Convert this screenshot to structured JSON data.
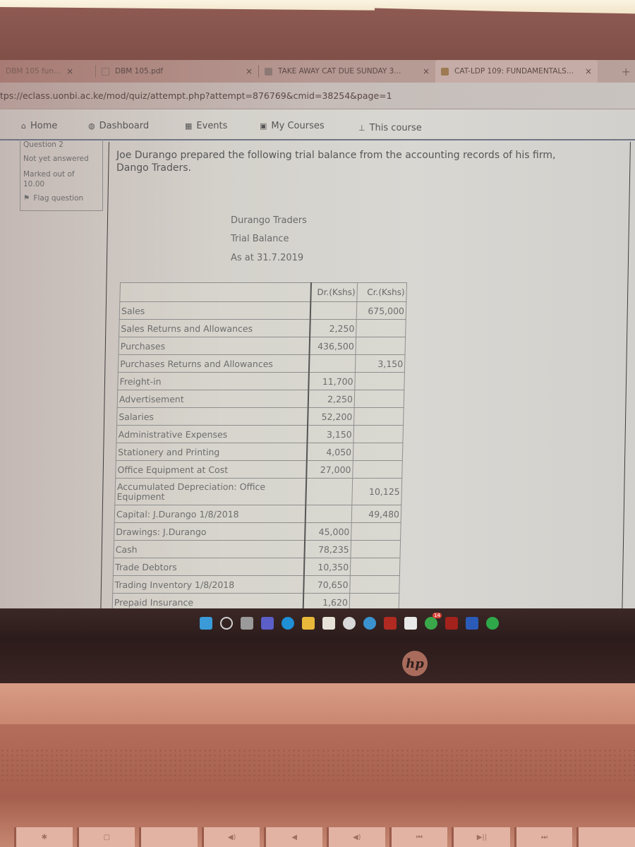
{
  "browser": {
    "tabs": [
      {
        "label": "DBM 105 fun...",
        "active": false
      },
      {
        "label": "DBM 105.pdf",
        "active": false
      },
      {
        "label": "TAKE AWAY CAT DUE SUNDAY 3...",
        "active": false
      },
      {
        "label": "CAT-LDP 109: FUNDAMENTALS...",
        "active": true
      }
    ],
    "close_glyph": "×",
    "new_tab_glyph": "+",
    "url": "tps://eclass.uonbi.ac.ke/mod/quiz/attempt.php?attempt=876769&cmid=38254&page=1"
  },
  "nav": {
    "items": [
      {
        "label": "Home",
        "icon": "home-icon",
        "glyph": "⌂"
      },
      {
        "label": "Dashboard",
        "icon": "dashboard-icon",
        "glyph": "◍"
      },
      {
        "label": "Events",
        "icon": "calendar-icon",
        "glyph": "▦"
      },
      {
        "label": "My Courses",
        "icon": "briefcase-icon",
        "glyph": "▣"
      },
      {
        "label": "This course",
        "icon": "sitemap-icon",
        "glyph": "⊥"
      }
    ]
  },
  "question_info": {
    "number": "Question 2",
    "status": "Not yet answered",
    "marked_label": "Marked out of",
    "marked_value": "10.00",
    "flag_label": "Flag question",
    "flag_glyph": "⚑"
  },
  "question": {
    "text": "Joe Durango prepared the following trial balance from the accounting records of his firm, Dango Traders.",
    "heading": [
      "Durango Traders",
      "Trial Balance",
      "As at 31.7.2019"
    ]
  },
  "trial_balance": {
    "headers": [
      "",
      "Dr.(Kshs)",
      "Cr.(Kshs)"
    ],
    "rows": [
      {
        "account": "Sales",
        "dr": "",
        "cr": "675,000"
      },
      {
        "account": "Sales Returns and Allowances",
        "dr": "2,250",
        "cr": ""
      },
      {
        "account": "Purchases",
        "dr": "436,500",
        "cr": ""
      },
      {
        "account": "Purchases Returns and Allowances",
        "dr": "",
        "cr": "3,150"
      },
      {
        "account": "Freight-in",
        "dr": "11,700",
        "cr": ""
      },
      {
        "account": "Advertisement",
        "dr": "2,250",
        "cr": ""
      },
      {
        "account": "Salaries",
        "dr": "52,200",
        "cr": ""
      },
      {
        "account": "Administrative Expenses",
        "dr": "3,150",
        "cr": ""
      },
      {
        "account": "Stationery and Printing",
        "dr": "4,050",
        "cr": ""
      },
      {
        "account": "Office Equipment at Cost",
        "dr": "27,000",
        "cr": ""
      },
      {
        "account": "Accumulated Depreciation: Office Equipment",
        "dr": "",
        "cr": "10,125"
      },
      {
        "account": "Capital: J.Durango 1/8/2018",
        "dr": "",
        "cr": "49,480"
      },
      {
        "account": "Drawings: J.Durango",
        "dr": "45,000",
        "cr": ""
      },
      {
        "account": "Cash",
        "dr": "78,235",
        "cr": ""
      },
      {
        "account": "Trade Debtors",
        "dr": "10,350",
        "cr": ""
      },
      {
        "account": "Trading Inventory 1/8/2018",
        "dr": "70,650",
        "cr": ""
      },
      {
        "account": "Prepaid Insurance",
        "dr": "1,620",
        "cr": ""
      }
    ]
  },
  "taskbar": {
    "apps": [
      {
        "name": "start-icon",
        "color": "#3a9bd8"
      },
      {
        "name": "search-icon",
        "color": "#d0d0d0"
      },
      {
        "name": "task-view-icon",
        "color": "#9a9a9a"
      },
      {
        "name": "teams-icon",
        "color": "#5b5fc7"
      },
      {
        "name": "edge-icon",
        "color": "#1f8fd6"
      },
      {
        "name": "file-explorer-icon",
        "color": "#e9b83a"
      },
      {
        "name": "store-icon",
        "color": "#e6e2d8"
      },
      {
        "name": "headset-icon",
        "color": "#d8d8d8"
      },
      {
        "name": "help-icon",
        "color": "#3a93cf"
      },
      {
        "name": "mcafee-icon",
        "color": "#b02a22"
      },
      {
        "name": "wikipedia-icon",
        "color": "#e8e8e8"
      },
      {
        "name": "whatsapp-icon",
        "color": "#3aa84a"
      },
      {
        "name": "netflix-icon",
        "color": "#a3221c"
      },
      {
        "name": "word-icon",
        "color": "#2b5bb8"
      },
      {
        "name": "spotify-icon",
        "color": "#2fa84a"
      }
    ],
    "whatsapp_badge": "14"
  },
  "device": {
    "brand_logo": "hp",
    "fkeys": [
      "✱",
      "▢",
      "",
      "◀)",
      "◀",
      "◀)",
      "⏮",
      "▶||",
      "⏭",
      ""
    ]
  }
}
